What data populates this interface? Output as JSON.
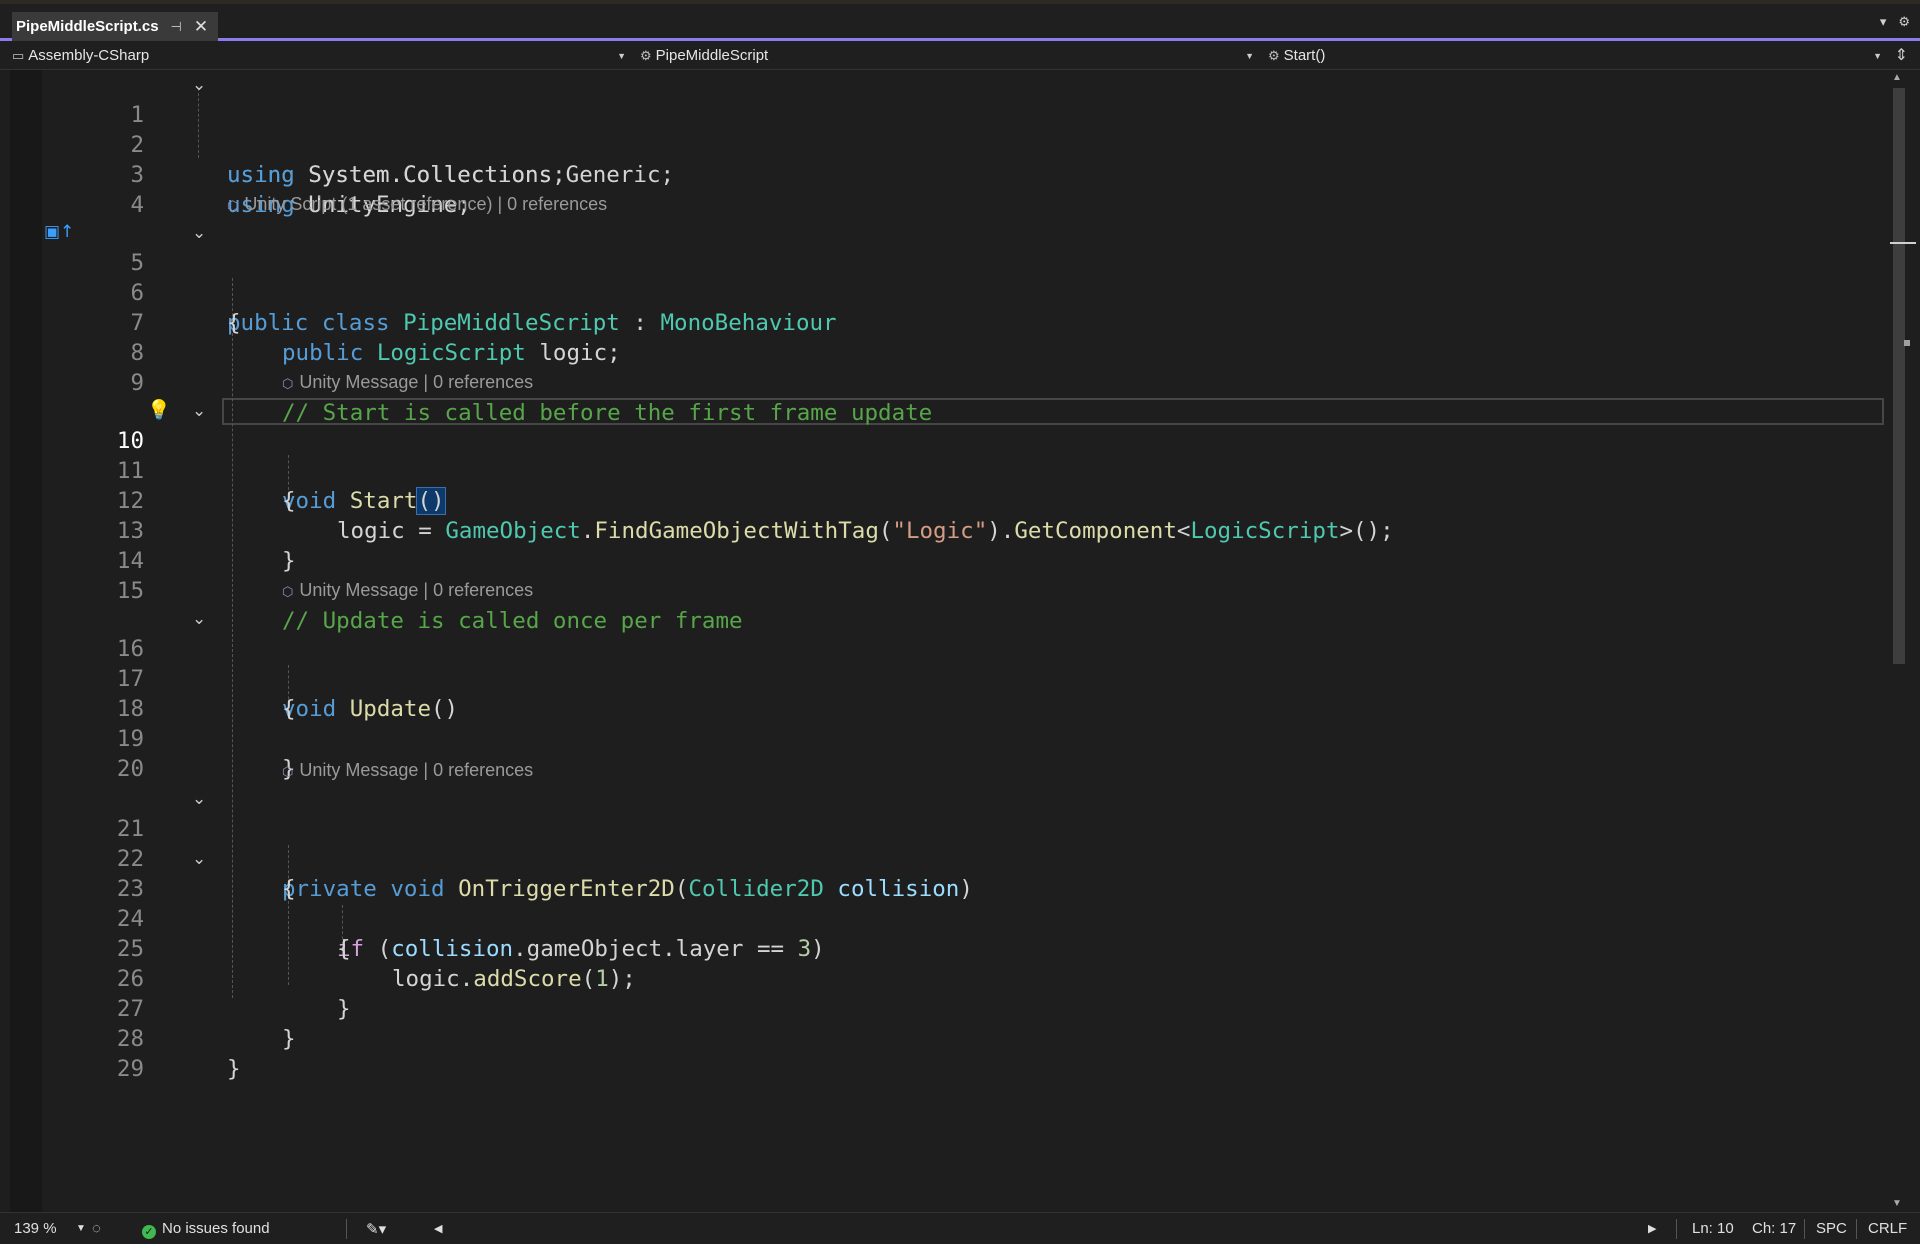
{
  "tab": {
    "title": "PipeMiddleScript.cs",
    "pin_icon": "pin-icon",
    "close_icon": "close-icon"
  },
  "nav": {
    "project": "Assembly-CSharp",
    "class": "PipeMiddleScript",
    "member": "Start()"
  },
  "code": {
    "lens_script": "Unity Script (1 asset reference) | 0 references",
    "lens_msg": "Unity Message | 0 references",
    "line_numbers": [
      "1",
      "2",
      "3",
      "4",
      "5",
      "6",
      "7",
      "8",
      "9",
      "10",
      "11",
      "12",
      "13",
      "14",
      "15",
      "16",
      "17",
      "18",
      "19",
      "20",
      "21",
      "22",
      "23",
      "24",
      "25",
      "26",
      "27",
      "28",
      "29"
    ],
    "l1": [
      "using",
      " System",
      ".",
      "Collections",
      ";"
    ],
    "l2": [
      "using",
      " System",
      ".",
      "Collections",
      ".",
      "Generic",
      ";"
    ],
    "l3": [
      "using",
      " UnityEngine",
      ";"
    ],
    "l5": [
      "public",
      " class ",
      "PipeMiddleScript",
      " : ",
      "MonoBehaviour"
    ],
    "l6": "{",
    "l7": [
      "public ",
      "LogicScript",
      " logic;"
    ],
    "l9": "// Start is called before the first frame update",
    "l10": [
      "void ",
      "Start",
      "()"
    ],
    "l11": "{",
    "l12": [
      "logic = ",
      "GameObject",
      ".",
      "FindGameObjectWithTag",
      "(",
      "\"Logic\"",
      ").",
      "GetComponent",
      "<",
      "LogicScript",
      ">();"
    ],
    "l13": "}",
    "l15": "// Update is called once per frame",
    "l16": [
      "void ",
      "Update",
      "()"
    ],
    "l17": "{",
    "l19": "}",
    "l21": [
      "private",
      " void ",
      "OnTriggerEnter2D",
      "(",
      "Collider2D",
      " collision",
      ")"
    ],
    "l22": "{",
    "l23": [
      "if",
      " (",
      "collision",
      ".",
      "gameObject",
      ".",
      "layer",
      " == ",
      "3",
      ")"
    ],
    "l24": "{",
    "l25": [
      "logic",
      ".",
      "addScore",
      "(",
      "1",
      ");"
    ],
    "l26": "}",
    "l27": "}",
    "l28": "}"
  },
  "status": {
    "zoom": "139 %",
    "issues": "No issues found",
    "line": "Ln: 10",
    "char": "Ch: 17",
    "spacing": "SPC",
    "eol": "CRLF"
  },
  "colors": {
    "accent": "#8a7cf0",
    "keyword": "#569cd6",
    "type": "#4ec9b0",
    "method": "#dcdcaa",
    "comment": "#57a64a",
    "string": "#d69d85",
    "ok": "#3fb950"
  }
}
